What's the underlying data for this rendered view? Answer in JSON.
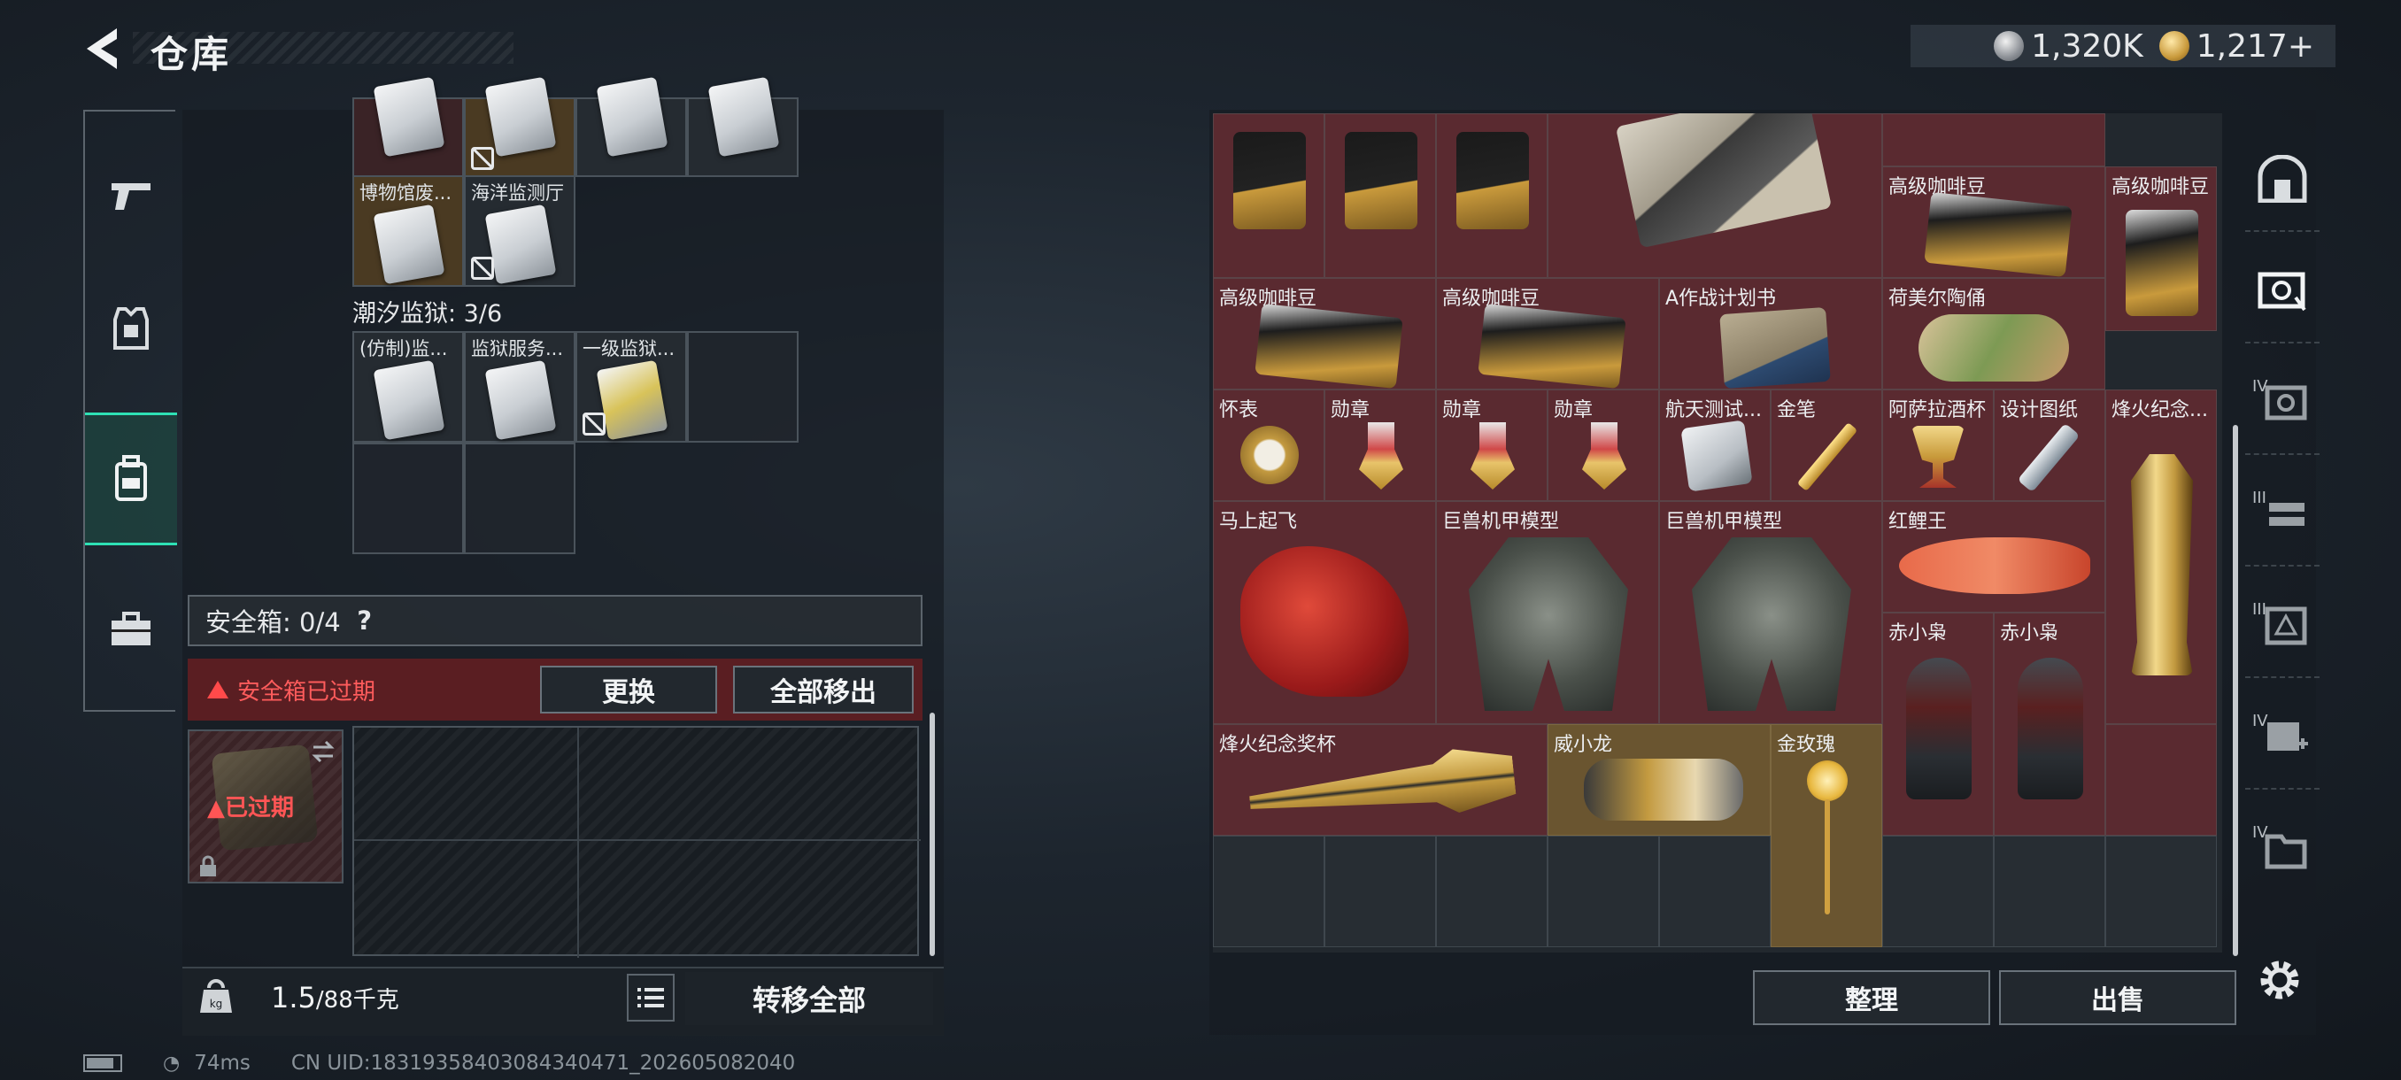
{
  "header": {
    "title": "仓库",
    "currency": [
      {
        "icon": "silver-coin-icon",
        "value": "1,320K"
      },
      {
        "icon": "gold-coin-icon",
        "value": "1,217+"
      }
    ]
  },
  "left_nav": [
    {
      "icon": "pistol-icon"
    },
    {
      "icon": "armor-vest-icon"
    },
    {
      "icon": "backpack-icon",
      "active": true
    },
    {
      "icon": "briefcase-icon"
    }
  ],
  "container": {
    "row0_labels": [
      "",
      "",
      "",
      ""
    ],
    "row1_labels": [
      "博物馆废...",
      "海洋监测厅"
    ],
    "prison_count": "潮汐监狱: 3/6",
    "prison_labels": [
      "(仿制)监...",
      "监狱服务...",
      "一级监狱..."
    ]
  },
  "safe": {
    "header": "安全箱: 0/4",
    "help": "?",
    "expired_msg": "安全箱已过期",
    "replace_label": "更换",
    "move_all_label": "全部移出",
    "slot_status": "已过期"
  },
  "bottom": {
    "weight": "1.5",
    "weight_unit": "/88千克",
    "transfer_label": "转移全部"
  },
  "stash": {
    "items": [
      {
        "label": "高级咖啡豆"
      },
      {
        "label": "高级咖啡豆"
      },
      {
        "label": "高级咖啡豆"
      },
      {
        "label": "高级咖啡豆"
      },
      {
        "label": "A作战计划书"
      },
      {
        "label": "荷美尔陶俑"
      },
      {
        "label": "怀表"
      },
      {
        "label": "勋章"
      },
      {
        "label": "勋章"
      },
      {
        "label": "勋章"
      },
      {
        "label": "航天测试..."
      },
      {
        "label": "金笔"
      },
      {
        "label": "阿萨拉酒杯"
      },
      {
        "label": "设计图纸"
      },
      {
        "label": "烽火纪念..."
      },
      {
        "label": "马上起飞"
      },
      {
        "label": "巨兽机甲模型"
      },
      {
        "label": "巨兽机甲模型"
      },
      {
        "label": "红鲤王"
      },
      {
        "label": "赤小枭"
      },
      {
        "label": "赤小枭"
      },
      {
        "label": "烽火纪念奖杯"
      },
      {
        "label": "威小龙"
      },
      {
        "label": "金玫瑰"
      }
    ],
    "sort_label": "整理",
    "sell_label": "出售"
  },
  "right_nav": [
    {
      "icon": "arch-door-icon",
      "level": ""
    },
    {
      "icon": "safe-box-icon",
      "level": ""
    },
    {
      "icon": "safe-box-iv-icon",
      "level": "IV"
    },
    {
      "icon": "rack-iii-icon",
      "level": "III"
    },
    {
      "icon": "warning-box-iii-icon",
      "level": "III"
    },
    {
      "icon": "add-box-iv-icon",
      "level": "IV"
    },
    {
      "icon": "folder-iv-icon",
      "level": "IV"
    }
  ],
  "footer": {
    "ping": "74ms",
    "uid": "CN UID:18319358403084340471_202605082040"
  }
}
